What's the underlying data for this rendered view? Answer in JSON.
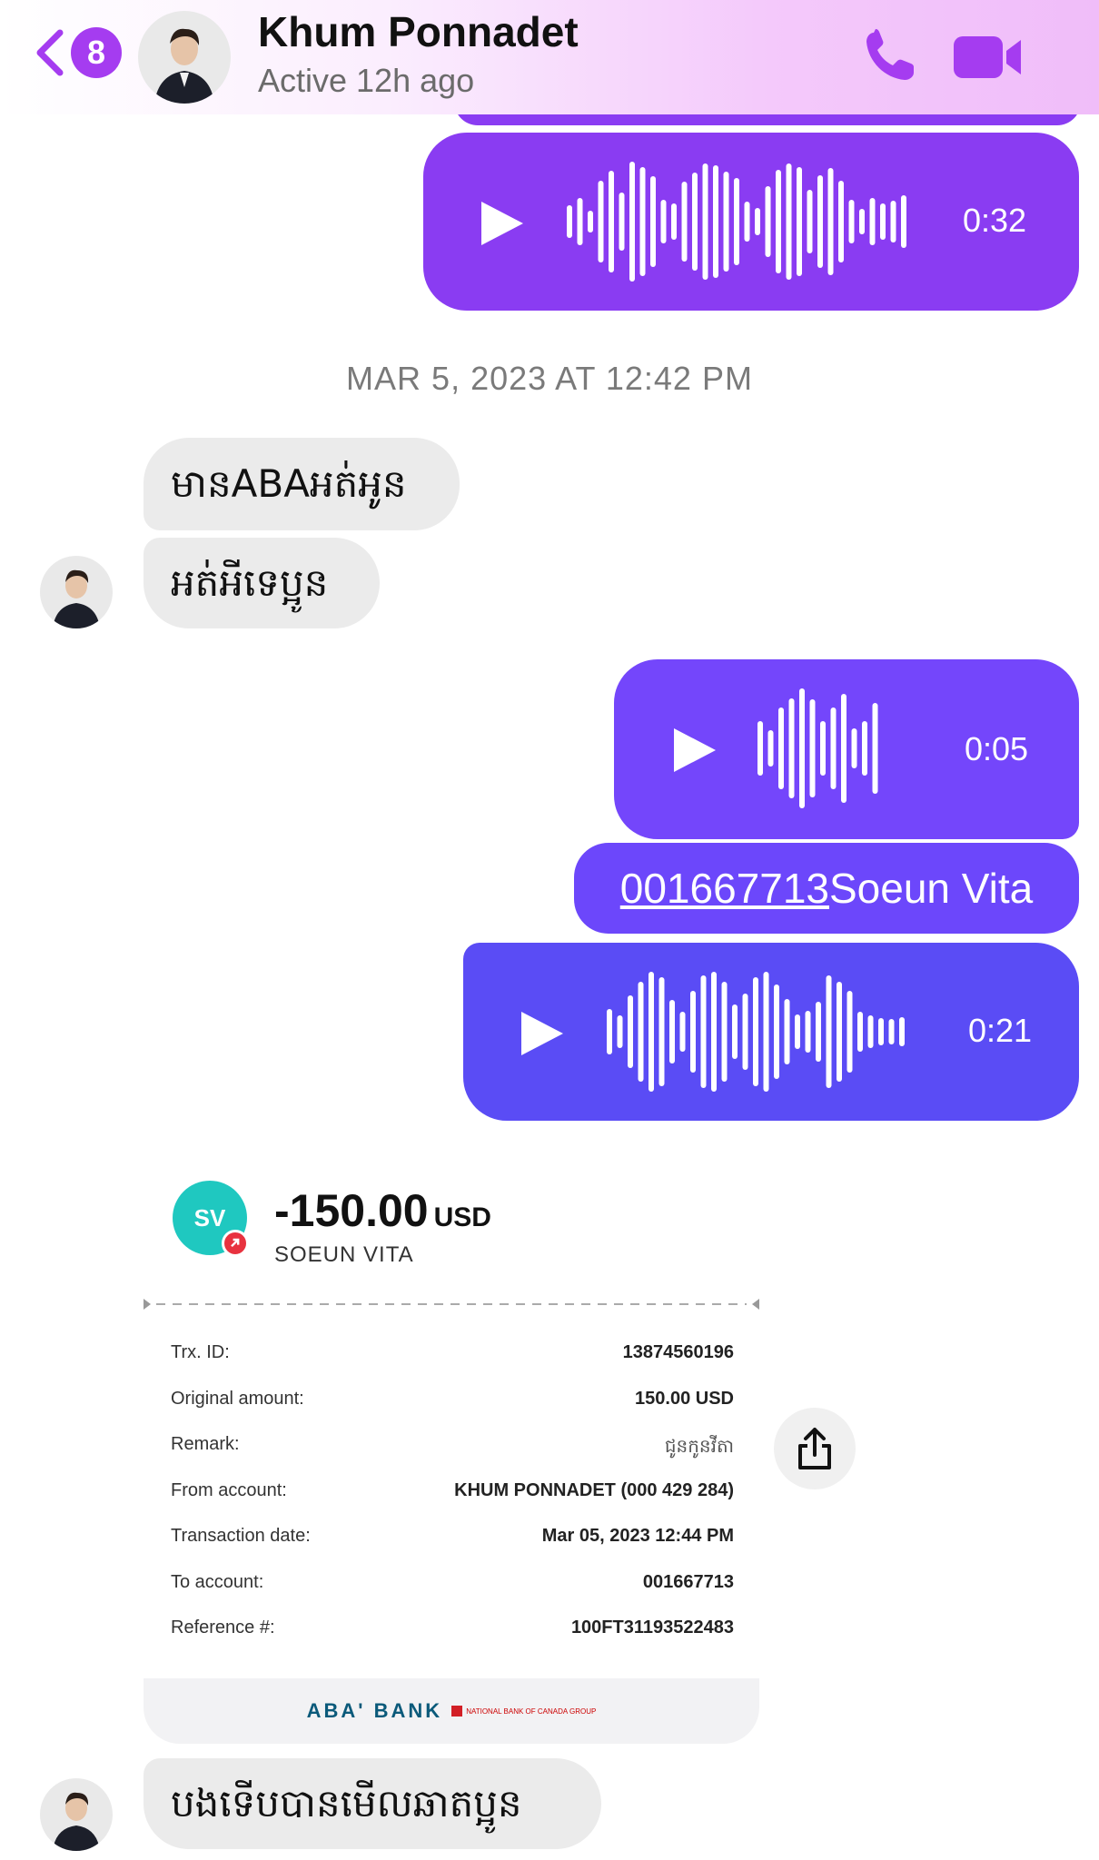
{
  "header": {
    "unread_count": "8",
    "contact_name": "Khum Ponnadet",
    "status": "Active 12h ago"
  },
  "messages": {
    "voice_1": {
      "duration": "0:32"
    },
    "timestamp": "MAR 5, 2023 AT 12:42 PM",
    "incoming_1": "មានABAអត់អូន",
    "incoming_2": "អត់អីទេប្អូន",
    "voice_2": {
      "duration": "0:05"
    },
    "link_message": {
      "account": "001667713",
      "name": " Soeun Vita"
    },
    "voice_3": {
      "duration": "0:21"
    },
    "incoming_3": "បងទើបបានមើលឆាតប្អូន"
  },
  "receipt": {
    "initials": "SV",
    "amount": "-150.00",
    "currency": "USD",
    "payee": "SOEUN VITA",
    "rows": [
      {
        "label": "Trx. ID:",
        "value": "13874560196"
      },
      {
        "label": "Original amount:",
        "value": "150.00 USD"
      },
      {
        "label": "Remark:",
        "value": "ជូនកូនវីតា"
      },
      {
        "label": "From account:",
        "value": "KHUM PONNADET (000 429 284)"
      },
      {
        "label": "Transaction date:",
        "value": "Mar 05, 2023 12:44 PM"
      },
      {
        "label": "To account:",
        "value": "001667713"
      },
      {
        "label": "Reference #:",
        "value": "100FT31193522483"
      }
    ],
    "bank_logo": "ABA' BANK",
    "partner_logo": "NATIONAL BANK OF CANADA GROUP"
  },
  "colors": {
    "accent": "#a53cf0",
    "voice_1_bg": "#8a3cf2",
    "voice_2_bg": "#7446fb",
    "link_bg": "#6c47fb",
    "voice_3_bg": "#5a4cf5",
    "incoming_bg": "#ebebeb",
    "sv_teal": "#1fc8c0"
  },
  "icons": {
    "back": "chevron-left-icon",
    "call": "phone-icon",
    "video": "video-camera-icon",
    "play": "play-icon",
    "share": "share-icon"
  }
}
